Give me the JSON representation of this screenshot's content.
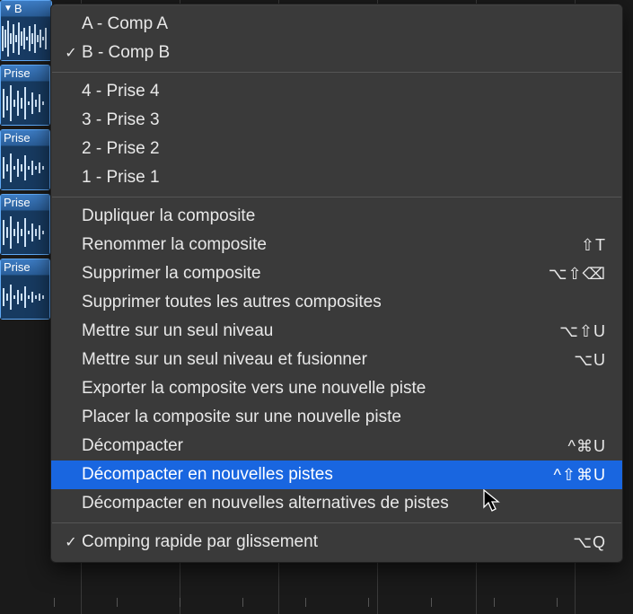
{
  "tracks": {
    "header_label": "B",
    "take_labels": [
      "Prise",
      "Prise",
      "Prise",
      "Prise"
    ]
  },
  "menu": {
    "groups": [
      {
        "items": [
          {
            "label": "A - Comp A",
            "checked": false,
            "shortcut": ""
          },
          {
            "label": "B - Comp B",
            "checked": true,
            "shortcut": ""
          }
        ]
      },
      {
        "items": [
          {
            "label": "4 - Prise 4",
            "checked": false,
            "shortcut": ""
          },
          {
            "label": "3 - Prise 3",
            "checked": false,
            "shortcut": ""
          },
          {
            "label": "2 - Prise 2",
            "checked": false,
            "shortcut": ""
          },
          {
            "label": "1 - Prise 1",
            "checked": false,
            "shortcut": ""
          }
        ]
      },
      {
        "items": [
          {
            "label": "Dupliquer la composite",
            "checked": false,
            "shortcut": ""
          },
          {
            "label": "Renommer la composite",
            "checked": false,
            "shortcut": "⇧T"
          },
          {
            "label": "Supprimer la composite",
            "checked": false,
            "shortcut": "⌥⇧⌫"
          },
          {
            "label": "Supprimer toutes les autres composites",
            "checked": false,
            "shortcut": ""
          },
          {
            "label": "Mettre sur un seul niveau",
            "checked": false,
            "shortcut": "⌥⇧U"
          },
          {
            "label": "Mettre sur un seul niveau et fusionner",
            "checked": false,
            "shortcut": "⌥U"
          },
          {
            "label": "Exporter la composite vers une nouvelle piste",
            "checked": false,
            "shortcut": ""
          },
          {
            "label": "Placer la composite sur une nouvelle piste",
            "checked": false,
            "shortcut": ""
          },
          {
            "label": "Décompacter",
            "checked": false,
            "shortcut": "^⌘U"
          },
          {
            "label": "Décompacter en nouvelles pistes",
            "checked": false,
            "shortcut": "^⇧⌘U",
            "highlight": true
          },
          {
            "label": "Décompacter en nouvelles alternatives de pistes",
            "checked": false,
            "shortcut": ""
          }
        ]
      },
      {
        "items": [
          {
            "label": "Comping rapide par glissement",
            "checked": true,
            "shortcut": "⌥Q"
          }
        ]
      }
    ]
  }
}
